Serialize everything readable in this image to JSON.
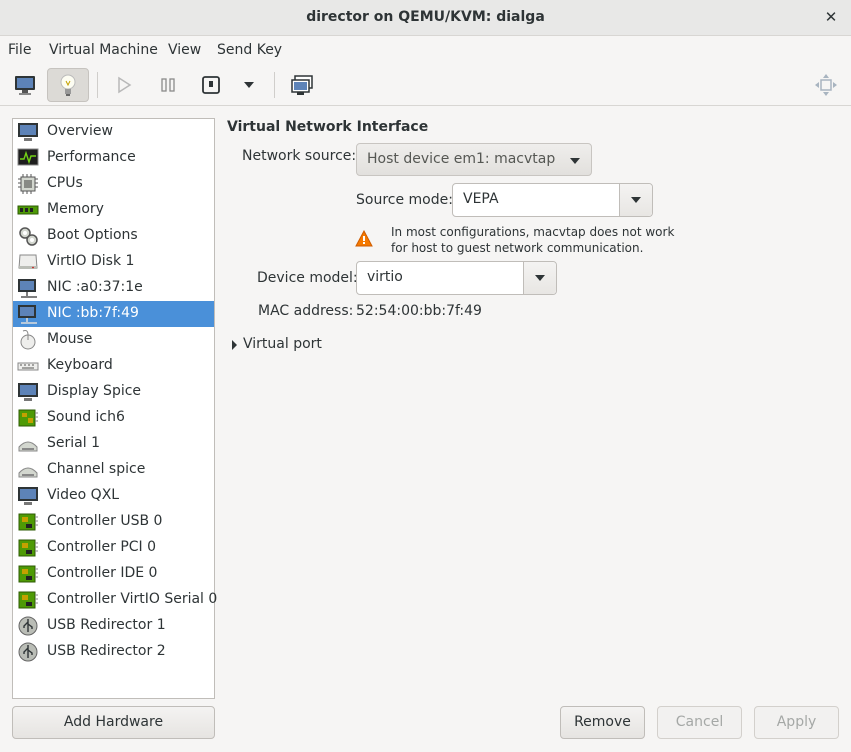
{
  "window": {
    "title": "director on QEMU/KVM: dialga"
  },
  "menubar": [
    "File",
    "Virtual Machine",
    "View",
    "Send Key"
  ],
  "sidebar": {
    "items": [
      {
        "label": "Overview",
        "icon": "overview-icon"
      },
      {
        "label": "Performance",
        "icon": "performance-icon"
      },
      {
        "label": "CPUs",
        "icon": "cpu-icon"
      },
      {
        "label": "Memory",
        "icon": "memory-icon"
      },
      {
        "label": "Boot Options",
        "icon": "boot-options-icon"
      },
      {
        "label": "VirtIO Disk 1",
        "icon": "disk-icon"
      },
      {
        "label": "NIC :a0:37:1e",
        "icon": "nic-icon"
      },
      {
        "label": "NIC :bb:7f:49",
        "icon": "nic-icon"
      },
      {
        "label": "Mouse",
        "icon": "mouse-icon"
      },
      {
        "label": "Keyboard",
        "icon": "keyboard-icon"
      },
      {
        "label": "Display Spice",
        "icon": "display-icon"
      },
      {
        "label": "Sound ich6",
        "icon": "sound-icon"
      },
      {
        "label": "Serial 1",
        "icon": "serial-icon"
      },
      {
        "label": "Channel spice",
        "icon": "channel-icon"
      },
      {
        "label": "Video QXL",
        "icon": "video-icon"
      },
      {
        "label": "Controller USB 0",
        "icon": "controller-icon"
      },
      {
        "label": "Controller PCI 0",
        "icon": "controller-icon"
      },
      {
        "label": "Controller IDE 0",
        "icon": "controller-icon"
      },
      {
        "label": "Controller VirtIO Serial 0",
        "icon": "controller-icon"
      },
      {
        "label": "USB Redirector 1",
        "icon": "usb-icon"
      },
      {
        "label": "USB Redirector 2",
        "icon": "usb-icon"
      }
    ],
    "selected_index": 7
  },
  "panel": {
    "title": "Virtual Network Interface",
    "network_source_label": "Network source:",
    "network_source_value": "Host device em1: macvtap",
    "source_mode_label": "Source mode:",
    "source_mode_value": "VEPA",
    "warning_text": "In most configurations, macvtap does not work for host to guest network communication.",
    "device_model_label": "Device model:",
    "device_model_value": "virtio",
    "mac_label": "MAC address:",
    "mac_value": "52:54:00:bb:7f:49",
    "virtual_port_label": "Virtual port"
  },
  "buttons": {
    "add_hardware": "Add Hardware",
    "remove": "Remove",
    "cancel": "Cancel",
    "apply": "Apply"
  },
  "colors": {
    "selection": "#4a90d9",
    "warning": "#f57900"
  }
}
